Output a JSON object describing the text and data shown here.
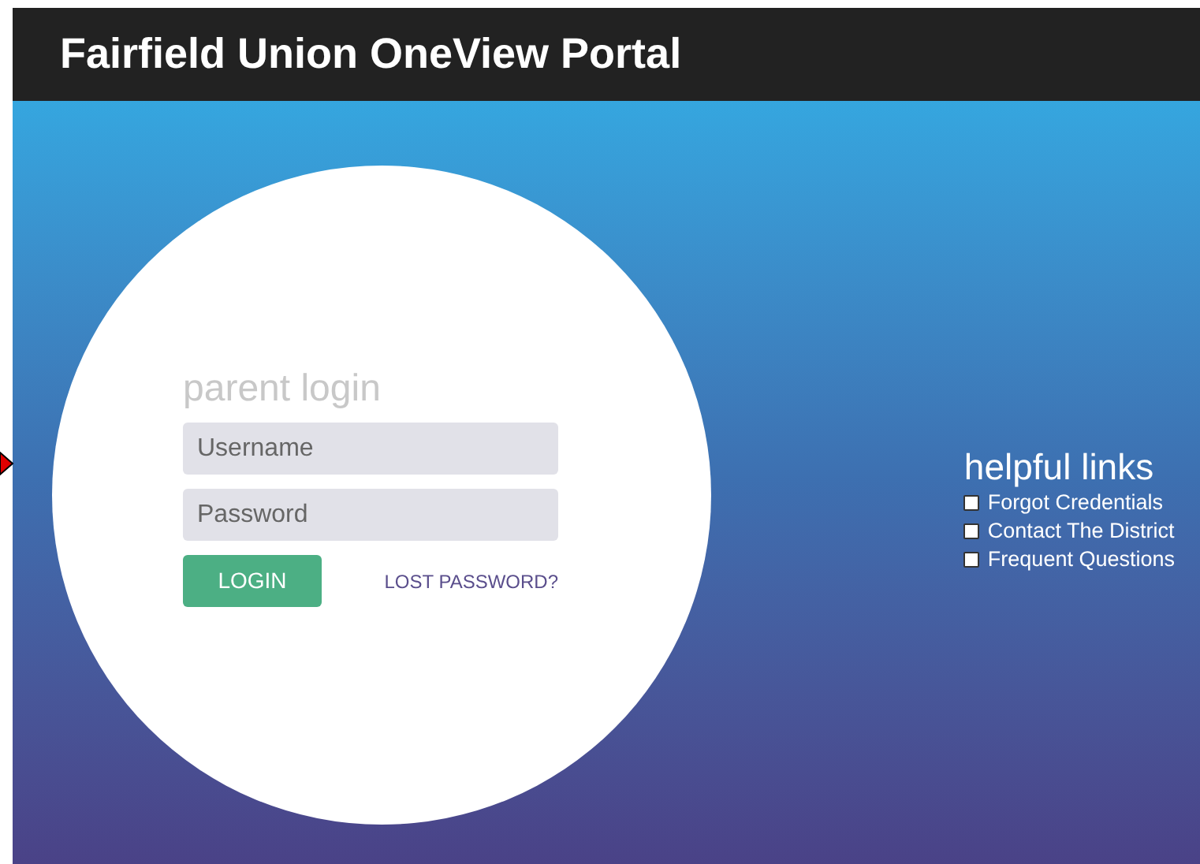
{
  "header": {
    "title": "Fairfield Union OneView Portal"
  },
  "login": {
    "title": "parent login",
    "username": {
      "placeholder": "Username"
    },
    "password": {
      "placeholder": "Password"
    },
    "button": "LOGIN",
    "lost_password": "LOST PASSWORD?"
  },
  "helpful_links": {
    "title": "helpful links",
    "items": [
      {
        "label": "Forgot Credentials",
        "checked": false
      },
      {
        "label": "Contact The District",
        "checked": false
      },
      {
        "label": "Frequent Questions",
        "checked": false
      }
    ]
  }
}
